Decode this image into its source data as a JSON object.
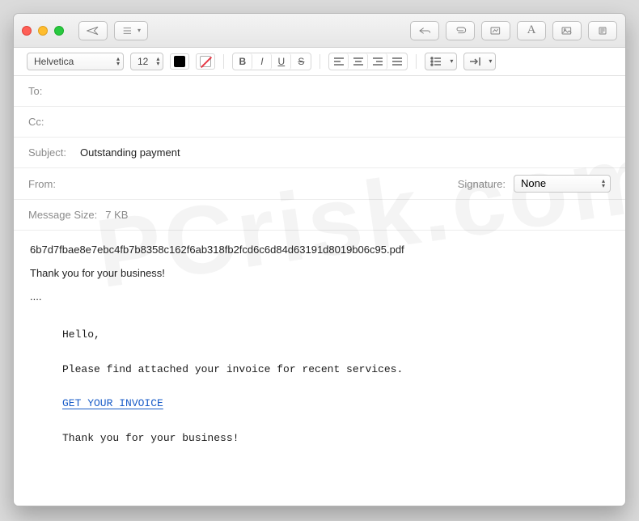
{
  "titlebar": {},
  "format": {
    "font": "Helvetica",
    "size": "12"
  },
  "headers": {
    "to_label": "To:",
    "cc_label": "Cc:",
    "subject_label": "Subject:",
    "subject_value": "Outstanding payment",
    "from_label": "From:",
    "signature_label": "Signature:",
    "signature_value": "None",
    "size_label": "Message Size:",
    "size_value": "7 KB"
  },
  "body": {
    "line1": "6b7d7fbae8e7ebc4fb7b8358c162f6ab318fb2fcd6c6d84d63191d8019b06c95.pdf",
    "line2": "Thank you for your business!",
    "line3": "....",
    "hello": "Hello,",
    "attach": "Please find attached your invoice for recent services.",
    "link": "GET YOUR INVOICE",
    "thanks": "Thank you for your business!"
  },
  "watermark": "PCrisk.com"
}
